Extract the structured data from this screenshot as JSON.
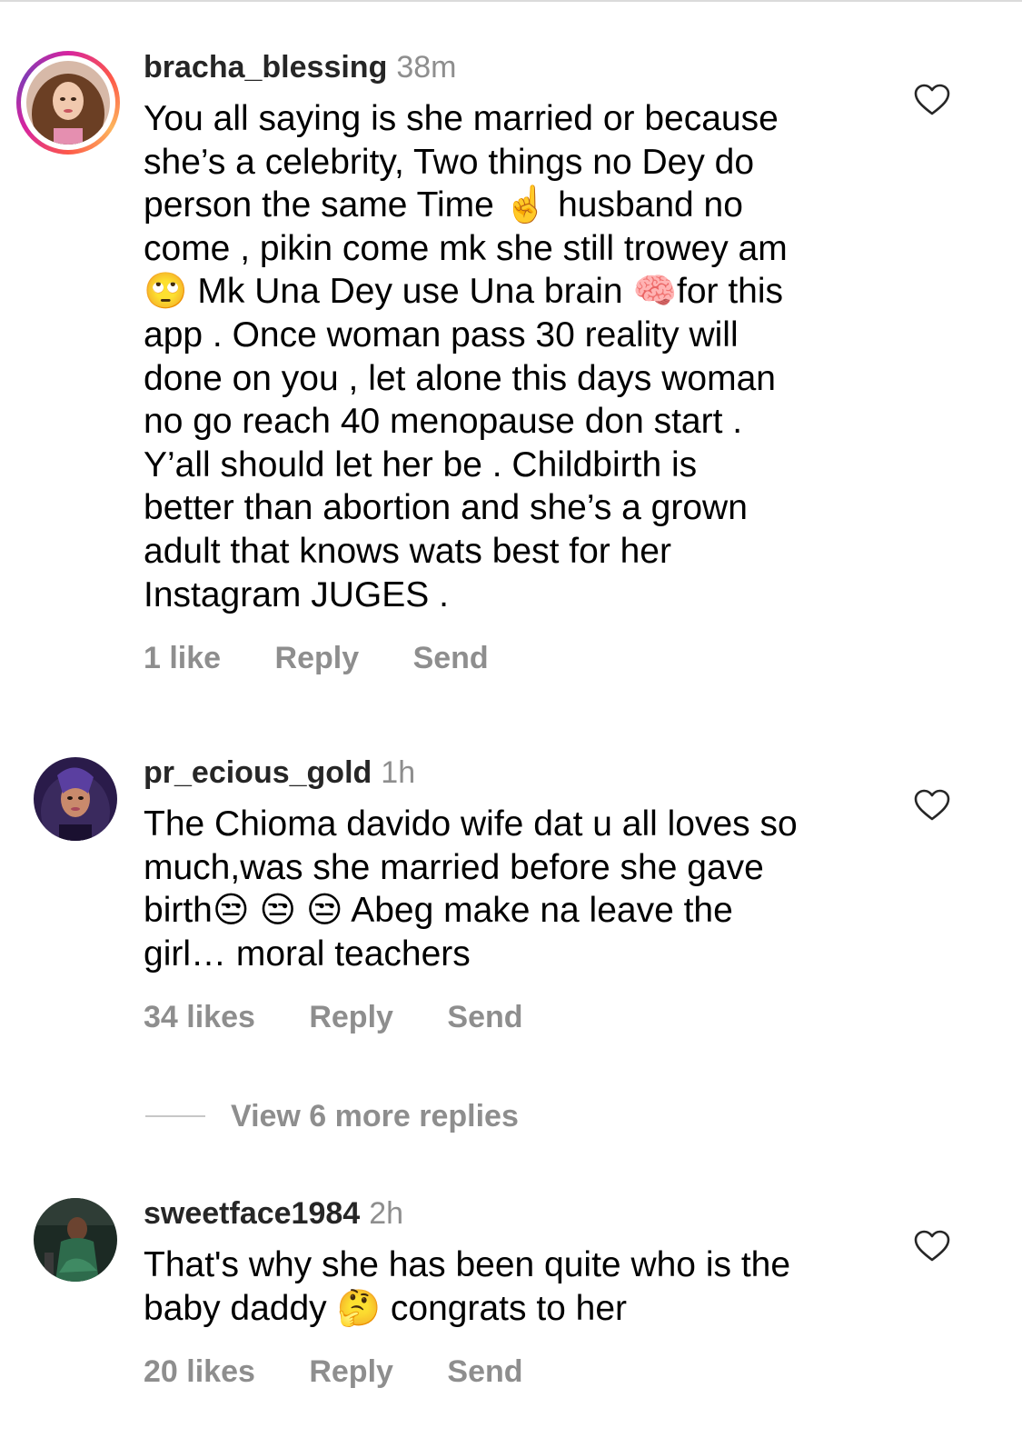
{
  "comments": [
    {
      "username": "bracha_blessing",
      "time": "38m",
      "lines": [
        "You all saying is she married or because",
        "she’s a celebrity, Two things no Dey do",
        "person the same Time ☝️  husband no",
        "come , pikin come mk she still trowey am",
        "🙄 Mk Una Dey use Una brain 🧠for this",
        "app . Once woman pass 30 reality will",
        "done on you , let alone this days woman",
        "no go reach 40 menopause don start .",
        "Y’all should let her be . Childbirth is",
        "better than abortion and she’s a grown",
        "adult that knows wats best for her",
        "Instagram JUGES ."
      ],
      "likes": "1 like",
      "reply_label": "Reply",
      "send_label": "Send"
    },
    {
      "username": "pr_ecious_gold",
      "time": "1h",
      "lines": [
        "The Chioma davido wife dat u all loves so",
        "much,was she married before she gave",
        "birth😒 😒 😒  Abeg make na leave the",
        "girl… moral teachers"
      ],
      "likes": "34 likes",
      "reply_label": "Reply",
      "send_label": "Send"
    },
    {
      "username": "sweetface1984",
      "time": "2h",
      "lines": [
        "That's why she has been quite who is the",
        "baby daddy 🤔  congrats to her"
      ],
      "likes": "20 likes",
      "reply_label": "Reply",
      "send_label": "Send"
    }
  ],
  "view_more_replies": "View 6 more replies",
  "icons": {
    "like": "heart-outline-icon"
  },
  "colors": {
    "text": "#000000",
    "username": "#262626",
    "secondary": "#8e8e8e"
  }
}
